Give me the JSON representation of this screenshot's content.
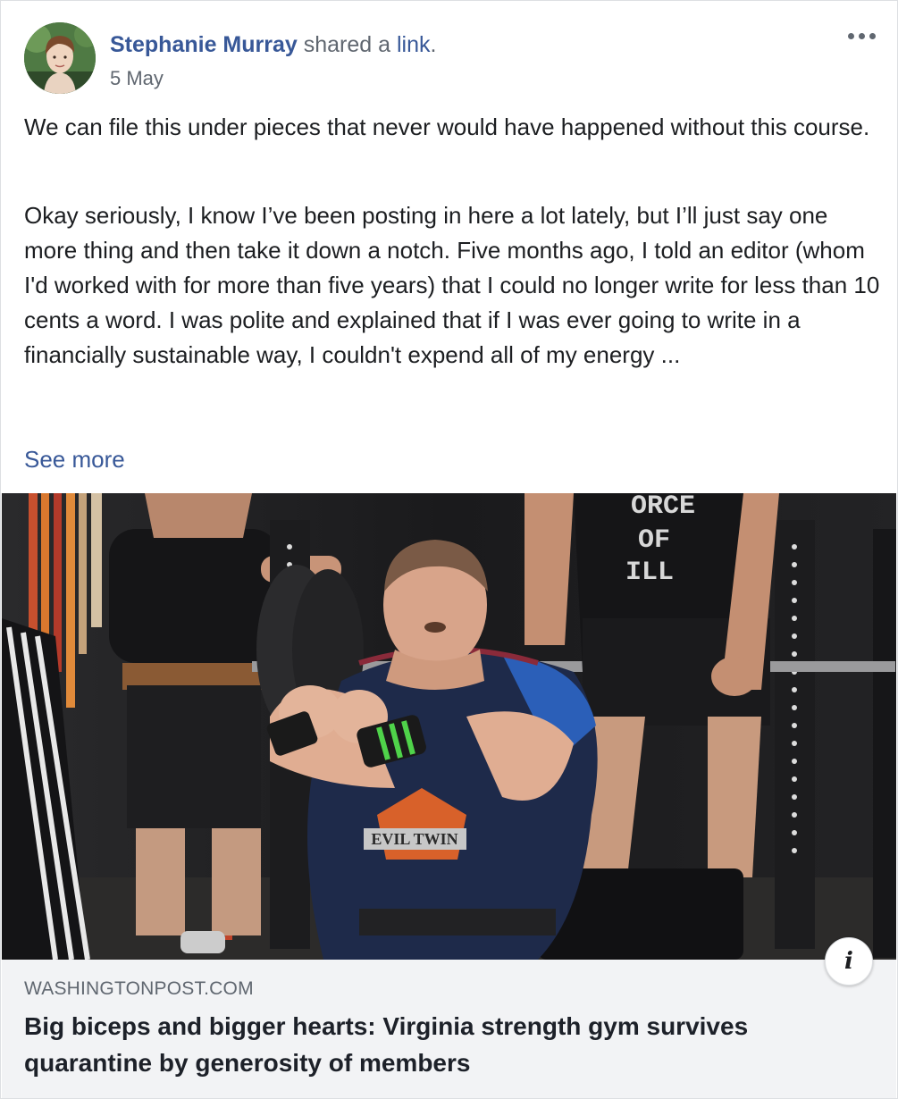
{
  "post": {
    "author_name": "Stephanie Murray",
    "shared_text": " shared a ",
    "link_word": "link",
    "shared_period": ".",
    "date": "5 May",
    "more_icon": "more-horizontal-icon",
    "paragraph_1": "We can file this under pieces that never would have happened without this course.",
    "paragraph_2": "Okay seriously, I know I’ve been posting in here a lot lately, but I’ll just say one more thing and then take it down a notch. Five months ago, I told an editor (whom I'd worked with for more than five years) that I could no longer write for less than 10 cents a word. I was polite and explained that if I was ever going to write in a financially sustainable way, I couldn't expend all of my energy ...",
    "see_more": "See more"
  },
  "link_preview": {
    "image_subject": "powerlifter-on-bench",
    "shirt_text_lines": [
      "ORCE",
      "OF",
      "ILL"
    ],
    "info_glyph": "i",
    "domain": "WASHINGTONPOST.COM",
    "title": "Big biceps and bigger hearts: Virginia strength gym survives quarantine by generosity of members"
  },
  "colors": {
    "link_blue": "#385898",
    "meta_gray": "#606770",
    "footer_bg": "#f2f3f5",
    "text": "#1c1e21"
  }
}
